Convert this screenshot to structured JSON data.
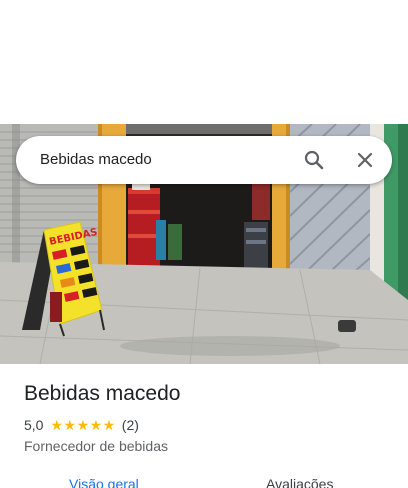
{
  "search": {
    "query": "Bebidas macedo",
    "search_icon": "search-icon",
    "close_icon": "close-icon"
  },
  "place": {
    "title": "Bebidas macedo",
    "rating": "5,0",
    "rating_stars": 5,
    "review_count": "(2)",
    "category": "Fornecedor de bebidas"
  },
  "photo": {
    "sign_text": "BEBIDAS"
  },
  "tabs": [
    {
      "label": "Visão geral",
      "active": true
    },
    {
      "label": "Avaliações",
      "active": false
    }
  ],
  "colors": {
    "accent": "#1a73e8",
    "star": "#fbbc04",
    "title_text": "#202124",
    "secondary_text": "#5f6368"
  }
}
